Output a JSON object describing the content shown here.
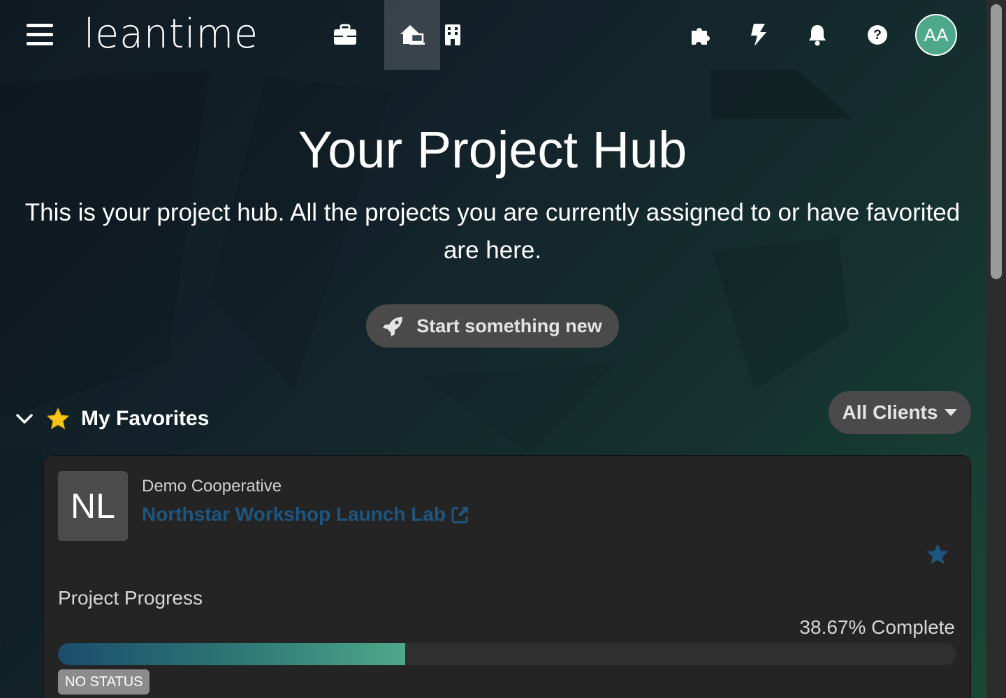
{
  "header": {
    "logo": "leantime",
    "user_initials": "AA",
    "active_nav": "my-work"
  },
  "hero": {
    "title": "Your Project Hub",
    "subtitle": "This is your project hub. All the projects you are currently assigned to or have favorited are here.",
    "start_button": "Start something new"
  },
  "favorites": {
    "title": "My Favorites",
    "client_filter": "All Clients"
  },
  "project": {
    "initials": "NL",
    "client": "Demo Cooperative",
    "name": "Northstar Workshop Launch Lab",
    "progress_label": "Project Progress",
    "progress_value": 38.67,
    "progress_text": "38.67% Complete",
    "status": "NO STATUS"
  },
  "colors": {
    "accent": "#4ea88a",
    "link": "#1e5680",
    "card": "#242424"
  }
}
